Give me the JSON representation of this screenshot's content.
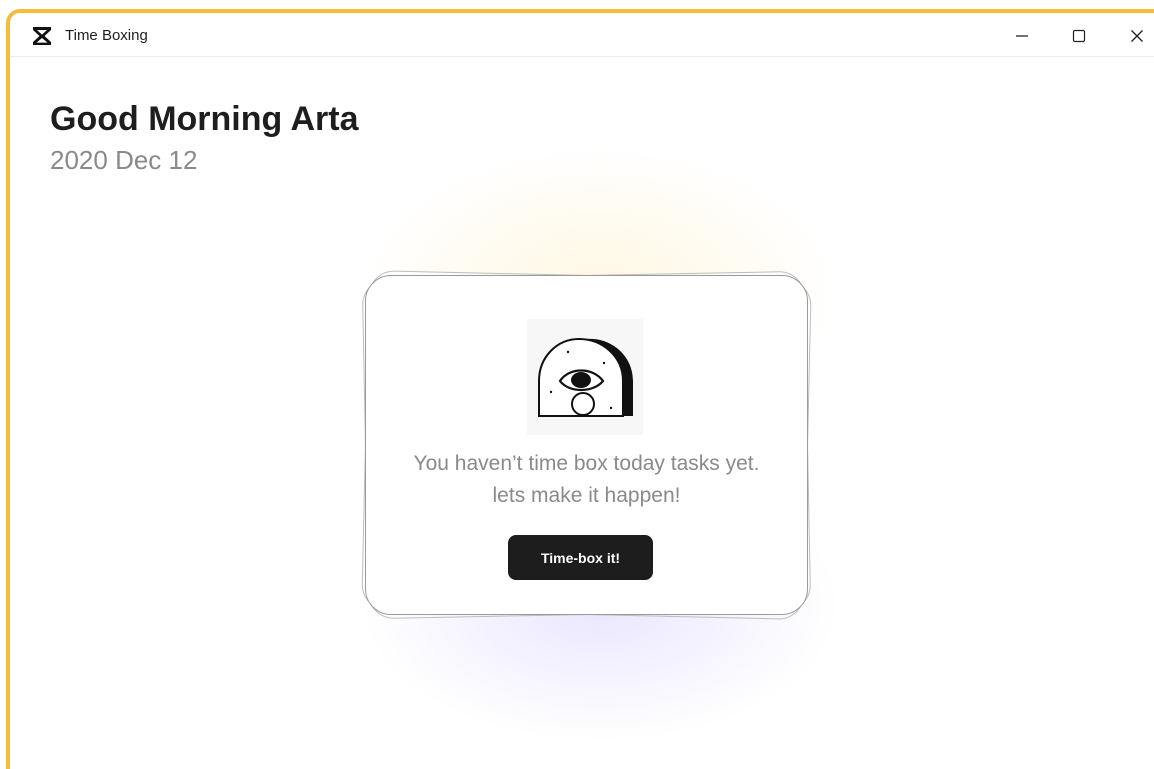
{
  "window": {
    "title": "Time Boxing",
    "app_icon": "hourglass-icon",
    "controls": {
      "minimize_icon": "minimize-icon",
      "maximize_icon": "maximize-icon",
      "close_icon": "close-icon"
    },
    "accent_color": "#f6bd3c"
  },
  "header": {
    "greeting": "Good Morning Arta",
    "date": "2020 Dec 12"
  },
  "empty_state": {
    "illustration": "eye-arch-illustration",
    "message_line1": "You haven’t time box today tasks yet.",
    "message_line2": "lets make it happen!",
    "button_label": "Time-box it!",
    "button_color": "#1d1d1d"
  }
}
